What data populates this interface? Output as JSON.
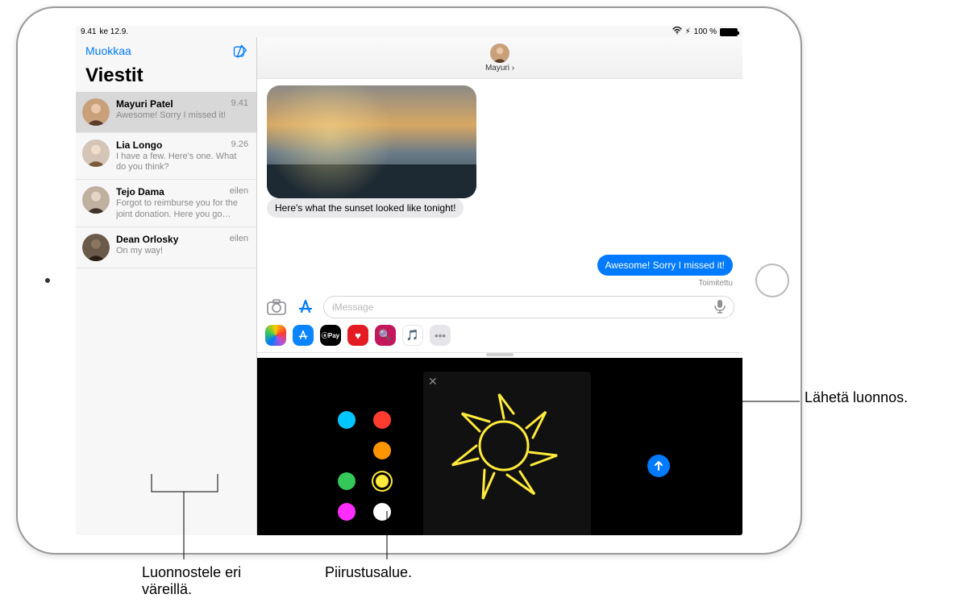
{
  "status_bar": {
    "time": "9.41",
    "date": "ke 12.9.",
    "battery_pct": "100 %",
    "charging_glyph": "⚡︎"
  },
  "sidebar": {
    "edit_label": "Muokkaa",
    "title": "Viestit",
    "conversations": [
      {
        "name": "Mayuri Patel",
        "time": "9.41",
        "preview": "Awesome! Sorry I missed it!"
      },
      {
        "name": "Lia Longo",
        "time": "9.26",
        "preview": "I have a few. Here's one. What do you think?"
      },
      {
        "name": "Tejo Dama",
        "time": "eilen",
        "preview": "Forgot to reimburse you for the joint donation. Here you go…"
      },
      {
        "name": "Dean Orlosky",
        "time": "eilen",
        "preview": "On my way!"
      }
    ]
  },
  "chat": {
    "contact_name": "Mayuri ›",
    "sunset_caption": "Here's what the sunset looked like tonight!",
    "reply_text": "Awesome! Sorry I missed it!",
    "delivered_label": "Toimitettu",
    "placeholder": "iMessage"
  },
  "app_strip": {
    "apps": [
      "photos",
      "appstore",
      "applepay",
      "digitaltouch",
      "search",
      "music",
      "more"
    ],
    "pay_label": "ⓐPay"
  },
  "colors": [
    "cyan",
    "red",
    "placeholder",
    "orange",
    "green",
    "yellow",
    "magenta",
    "white"
  ],
  "callouts": {
    "send": "Lähetä luonnos.",
    "colors": "Luonnostele eri väreillä.",
    "canvas": "Piirustusalue."
  }
}
